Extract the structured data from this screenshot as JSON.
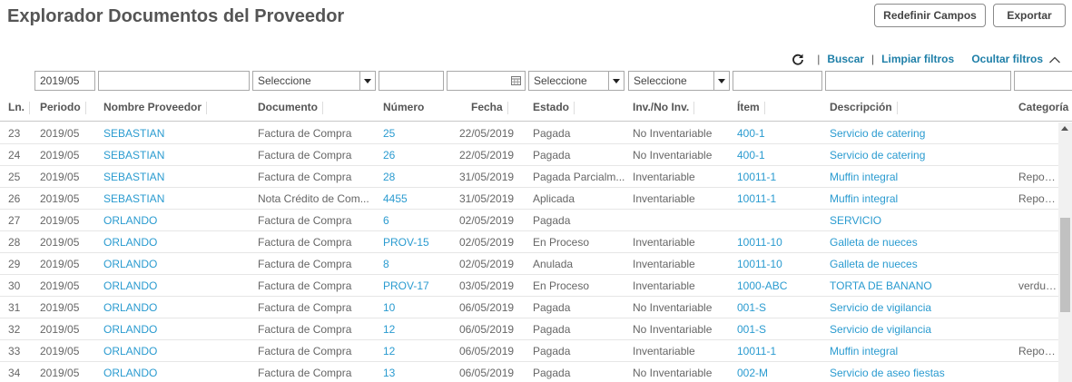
{
  "header": {
    "title": "Explorador Documentos del Proveedor",
    "redefinir_label": "Redefinir Campos",
    "exportar_label": "Exportar"
  },
  "toolbar": {
    "refresh_icon": "refresh-icon",
    "buscar_label": "Buscar",
    "limpiar_label": "Limpiar filtros",
    "ocultar_label": "Ocultar filtros",
    "chevron_icon": "chevron-up-icon"
  },
  "filters": {
    "periodo": "2019/05",
    "nombre_proveedor": "",
    "documento": "Seleccione",
    "numero": "",
    "fecha": "",
    "estado": "Seleccione",
    "inv": "Seleccione",
    "item": "",
    "descripcion": "",
    "categoria": ""
  },
  "columns": {
    "ln": "Ln.",
    "periodo": "Periodo",
    "proveedor": "Nombre Proveedor",
    "documento": "Documento",
    "numero": "Número",
    "fecha": "Fecha",
    "estado": "Estado",
    "inv": "Inv./No Inv.",
    "item": "Ítem",
    "descripcion": "Descripción",
    "categoria": "Categoría"
  },
  "rows": [
    {
      "ln": "23",
      "periodo": "2019/05",
      "proveedor": "SEBASTIAN",
      "documento": "Factura de Compra",
      "numero": "25",
      "fecha": "22/05/2019",
      "estado": "Pagada",
      "inv": "No Inventariable",
      "item": "400-1",
      "descripcion": "Servicio de catering",
      "categoria": ""
    },
    {
      "ln": "24",
      "periodo": "2019/05",
      "proveedor": "SEBASTIAN",
      "documento": "Factura de Compra",
      "numero": "26",
      "fecha": "22/05/2019",
      "estado": "Pagada",
      "inv": "No Inventariable",
      "item": "400-1",
      "descripcion": "Servicio de catering",
      "categoria": ""
    },
    {
      "ln": "25",
      "periodo": "2019/05",
      "proveedor": "SEBASTIAN",
      "documento": "Factura de Compra",
      "numero": "28",
      "fecha": "31/05/2019",
      "estado": "Pagada Parcialm...",
      "inv": "Inventariable",
      "item": "10011-1",
      "descripcion": "Muffin integral",
      "categoria": "Reposte"
    },
    {
      "ln": "26",
      "periodo": "2019/05",
      "proveedor": "SEBASTIAN",
      "documento": "Nota Crédito de Com...",
      "numero": "4455",
      "fecha": "31/05/2019",
      "estado": "Aplicada",
      "inv": "Inventariable",
      "item": "10011-1",
      "descripcion": "Muffin integral",
      "categoria": "Reposte"
    },
    {
      "ln": "27",
      "periodo": "2019/05",
      "proveedor": "ORLANDO",
      "documento": "Factura de Compra",
      "numero": "6",
      "fecha": "02/05/2019",
      "estado": "Pagada",
      "inv": "",
      "item": "",
      "descripcion": "SERVICIO",
      "categoria": ""
    },
    {
      "ln": "28",
      "periodo": "2019/05",
      "proveedor": "ORLANDO",
      "documento": "Factura de Compra",
      "numero": "PROV-15",
      "fecha": "02/05/2019",
      "estado": "En Proceso",
      "inv": "Inventariable",
      "item": "10011-10",
      "descripcion": "Galleta de nueces",
      "categoria": ""
    },
    {
      "ln": "29",
      "periodo": "2019/05",
      "proveedor": "ORLANDO",
      "documento": "Factura de Compra",
      "numero": "8",
      "fecha": "02/05/2019",
      "estado": "Anulada",
      "inv": "Inventariable",
      "item": "10011-10",
      "descripcion": "Galleta de nueces",
      "categoria": ""
    },
    {
      "ln": "30",
      "periodo": "2019/05",
      "proveedor": "ORLANDO",
      "documento": "Factura de Compra",
      "numero": "PROV-17",
      "fecha": "03/05/2019",
      "estado": "En Proceso",
      "inv": "Inventariable",
      "item": "1000-ABC",
      "descripcion": "TORTA DE BANANO",
      "categoria": "verduras"
    },
    {
      "ln": "31",
      "periodo": "2019/05",
      "proveedor": "ORLANDO",
      "documento": "Factura de Compra",
      "numero": "10",
      "fecha": "06/05/2019",
      "estado": "Pagada",
      "inv": "No Inventariable",
      "item": "001-S",
      "descripcion": "Servicio de vigilancia",
      "categoria": ""
    },
    {
      "ln": "32",
      "periodo": "2019/05",
      "proveedor": "ORLANDO",
      "documento": "Factura de Compra",
      "numero": "12",
      "fecha": "06/05/2019",
      "estado": "Pagada",
      "inv": "No Inventariable",
      "item": "001-S",
      "descripcion": "Servicio de vigilancia",
      "categoria": ""
    },
    {
      "ln": "33",
      "periodo": "2019/05",
      "proveedor": "ORLANDO",
      "documento": "Factura de Compra",
      "numero": "12",
      "fecha": "06/05/2019",
      "estado": "Pagada",
      "inv": "Inventariable",
      "item": "10011-1",
      "descripcion": "Muffin integral",
      "categoria": "Reposte"
    },
    {
      "ln": "34",
      "periodo": "2019/05",
      "proveedor": "ORLANDO",
      "documento": "Factura de Compra",
      "numero": "13",
      "fecha": "06/05/2019",
      "estado": "Pagada",
      "inv": "No Inventariable",
      "item": "002-M",
      "descripcion": "Servicio de aseo fiestas",
      "categoria": ""
    }
  ]
}
